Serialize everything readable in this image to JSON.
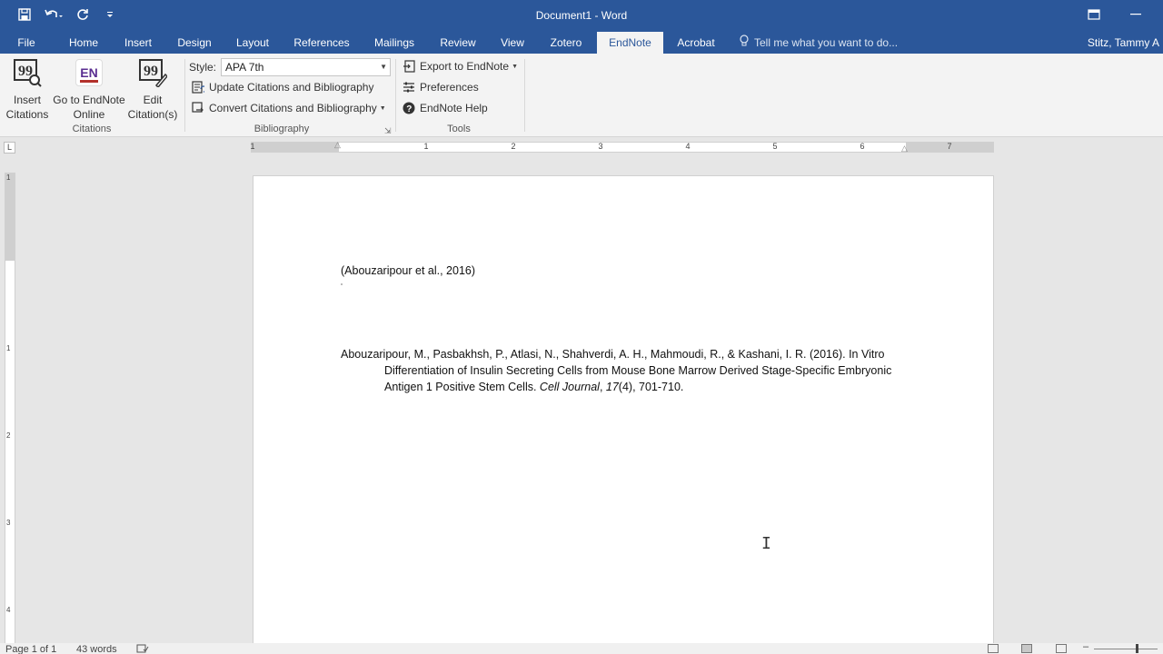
{
  "app": {
    "title": "Document1 - Word"
  },
  "qat": {
    "save_icon": "save-icon",
    "undo_icon": "undo-icon",
    "redo_icon": "redo-icon",
    "customize_icon": "customize-qat-icon"
  },
  "tabs": [
    {
      "label": "File"
    },
    {
      "label": "Home"
    },
    {
      "label": "Insert"
    },
    {
      "label": "Design"
    },
    {
      "label": "Layout"
    },
    {
      "label": "References"
    },
    {
      "label": "Mailings"
    },
    {
      "label": "Review"
    },
    {
      "label": "View"
    },
    {
      "label": "Zotero"
    },
    {
      "label": "EndNote"
    },
    {
      "label": "Acrobat"
    }
  ],
  "active_tab": "EndNote",
  "tell_me": "Tell me what you want to do...",
  "user": "Stitz, Tammy A",
  "ribbon": {
    "citations": {
      "group_label": "Citations",
      "insert_line1": "Insert",
      "insert_line2": "Citations",
      "goto_line1": "Go to EndNote",
      "goto_line2": "Online",
      "goto_icon_text": "EN",
      "edit_line1": "Edit",
      "edit_line2": "Citation(s)"
    },
    "bibliography": {
      "group_label": "Bibliography",
      "style_label": "Style:",
      "style_value": "APA 7th",
      "update": "Update Citations and Bibliography",
      "convert": "Convert Citations and Bibliography"
    },
    "tools": {
      "group_label": "Tools",
      "export": "Export to EndNote",
      "preferences": "Preferences",
      "help": "EndNote Help"
    }
  },
  "ruler": {
    "tab_selector": "L",
    "numbers": [
      "1",
      "1",
      "2",
      "3",
      "4",
      "5",
      "6",
      "7"
    ]
  },
  "vruler": {
    "numbers": [
      "1",
      "1",
      "2",
      "3",
      "4"
    ]
  },
  "document": {
    "citation": "(Abouzaripour et al., 2016)",
    "bib_prefix": "Abouzaripour, M., Pasbakhsh, P., Atlasi, N., Shahverdi, A. H., Mahmoudi, R., & Kashani, I. R. (2016). In Vitro Differentiation of Insulin Secreting Cells from Mouse Bone Marrow Derived Stage-Specific Embryonic Antigen 1 Positive Stem Cells. ",
    "bib_journal": "Cell Journal",
    "bib_sep": ", ",
    "bib_volume": "17",
    "bib_suffix": "(4), 701-710."
  },
  "status": {
    "page": "Page 1 of 1",
    "words": "43 words"
  },
  "colors": {
    "accent": "#2b579a",
    "endnote_red": "#b3312b",
    "endnote_purple": "#5a2d91"
  }
}
